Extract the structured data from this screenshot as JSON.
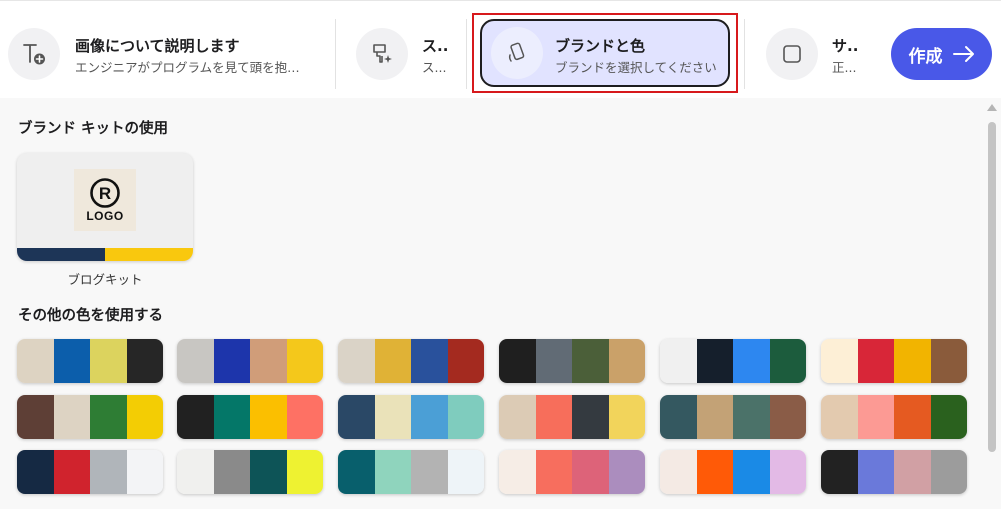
{
  "steps": [
    {
      "title": "画像について説明します",
      "sub": "エンジニアがプログラムを見て頭を抱…",
      "icon": "text-add-icon"
    },
    {
      "title": "ス..",
      "sub": "ス...",
      "icon": "style-brush-icon"
    },
    {
      "title": "ブランドと色",
      "sub": "ブランドを選択してください",
      "icon": "phone-tap-icon"
    },
    {
      "title": "サ..",
      "sub": "正...",
      "icon": "square-frame-icon"
    }
  ],
  "create_button": {
    "label": "作成",
    "icon": "arrow-right-icon"
  },
  "brand_kit": {
    "section_title": "ブランド キットの使用",
    "kit_name": "ブログキット",
    "logo_text": "LOGO",
    "logo_letter": "R",
    "bar_colors": [
      "#1d3557",
      "#f9c80e"
    ]
  },
  "other_colors": {
    "section_title": "その他の色を使用する",
    "palettes": [
      [
        "#ddd3c2",
        "#0c5eab",
        "#dcd35e",
        "#262626"
      ],
      [
        "#c8c6c2",
        "#1d35ab",
        "#d09d79",
        "#f4c81b"
      ],
      [
        "#dad3c7",
        "#e0b236",
        "#29519c",
        "#a42a1f"
      ],
      [
        "#1f1f1f",
        "#616b75",
        "#4b5f39",
        "#caa169"
      ],
      [
        "#f0f0f0",
        "#151f2c",
        "#2d87f0",
        "#1c5c3d"
      ],
      [
        "#fdefd6",
        "#d82638",
        "#f2b400",
        "#8a5b3b"
      ],
      [
        "#5e3f36",
        "#ddd3c3",
        "#2e7d34",
        "#f3cd04"
      ],
      [
        "#212121",
        "#047768",
        "#fbbf00",
        "#fe7164"
      ],
      [
        "#2a4866",
        "#eae2b9",
        "#4b9fd6",
        "#7fccbe"
      ],
      [
        "#dccbb5",
        "#f76e5b",
        "#343a40",
        "#f2d45b"
      ],
      [
        "#345860",
        "#c3a276",
        "#4b7269",
        "#8a5c47"
      ],
      [
        "#e3caaf",
        "#fc9a94",
        "#e55a21",
        "#2a611e"
      ],
      [
        "#152943",
        "#d0232d",
        "#b0b5ba",
        "#f3f4f6"
      ],
      [
        "#f0f0ee",
        "#8a8a8a",
        "#0d5457",
        "#eef231"
      ],
      [
        "#085f6c",
        "#8fd4bd",
        "#b3b3b3",
        "#eef4f8"
      ],
      [
        "#f6ede6",
        "#f76e5e",
        "#dd6379",
        "#ab8dbe"
      ],
      [
        "#f4eae4",
        "#ff5a07",
        "#1a8ae6",
        "#e3bae6"
      ],
      [
        "#222222",
        "#6a79da",
        "#d1a0a4",
        "#9c9c9c"
      ]
    ]
  }
}
